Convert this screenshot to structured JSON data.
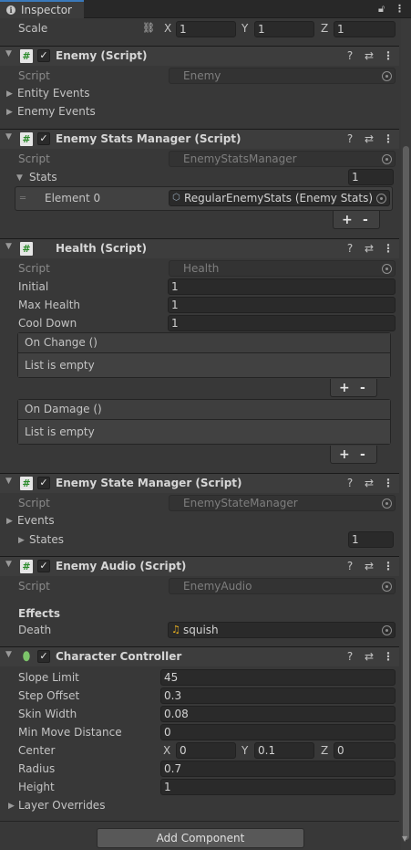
{
  "window": {
    "tab_label": "Inspector",
    "lock_icon": "lock-icon",
    "menu_icon": "kebab-menu-icon"
  },
  "transform_scale": {
    "label": "Scale",
    "x_label": "X",
    "x_value": "1",
    "y_label": "Y",
    "y_value": "1",
    "z_label": "Z",
    "z_value": "1"
  },
  "enemy_script": {
    "title": "Enemy (Script)",
    "script_label": "Script",
    "script_value": "Enemy",
    "foldouts": [
      "Entity Events",
      "Enemy Events"
    ]
  },
  "enemy_stats_manager": {
    "title": "Enemy Stats Manager (Script)",
    "script_label": "Script",
    "script_value": "EnemyStatsManager",
    "stats_label": "Stats",
    "stats_count": "1",
    "element_label": "Element 0",
    "element_value": "RegularEnemyStats (Enemy Stats)",
    "add": "+",
    "remove": "-"
  },
  "health": {
    "title": "Health (Script)",
    "script_label": "Script",
    "script_value": "Health",
    "fields": [
      {
        "label": "Initial",
        "value": "1"
      },
      {
        "label": "Max Health",
        "value": "1"
      },
      {
        "label": "Cool Down",
        "value": "1"
      }
    ],
    "on_change_header": "On Change ()",
    "on_change_empty": "List is empty",
    "on_damage_header": "On Damage ()",
    "on_damage_empty": "List is empty",
    "add": "+",
    "remove": "-"
  },
  "enemy_state_manager": {
    "title": "Enemy State Manager (Script)",
    "script_label": "Script",
    "script_value": "EnemyStateManager",
    "events_label": "Events",
    "states_label": "States",
    "states_count": "1"
  },
  "enemy_audio": {
    "title": "Enemy Audio (Script)",
    "script_label": "Script",
    "script_value": "EnemyAudio",
    "effects_heading": "Effects",
    "death_label": "Death",
    "death_value": "squish"
  },
  "character_controller": {
    "title": "Character Controller",
    "fields": [
      {
        "label": "Slope Limit",
        "value": "45"
      },
      {
        "label": "Step Offset",
        "value": "0.3"
      },
      {
        "label": "Skin Width",
        "value": "0.08"
      },
      {
        "label": "Min Move Distance",
        "value": "0"
      }
    ],
    "center_label": "Center",
    "center_x_label": "X",
    "center_x": "0",
    "center_y_label": "Y",
    "center_y": "0.1",
    "center_z_label": "Z",
    "center_z": "0",
    "radius_label": "Radius",
    "radius": "0.7",
    "height_label": "Height",
    "height": "1",
    "layer_overrides": "Layer Overrides"
  },
  "add_component": "Add Component",
  "colors": {
    "accent": "#3a79bb",
    "background": "#383838",
    "field": "#2a2a2a"
  }
}
